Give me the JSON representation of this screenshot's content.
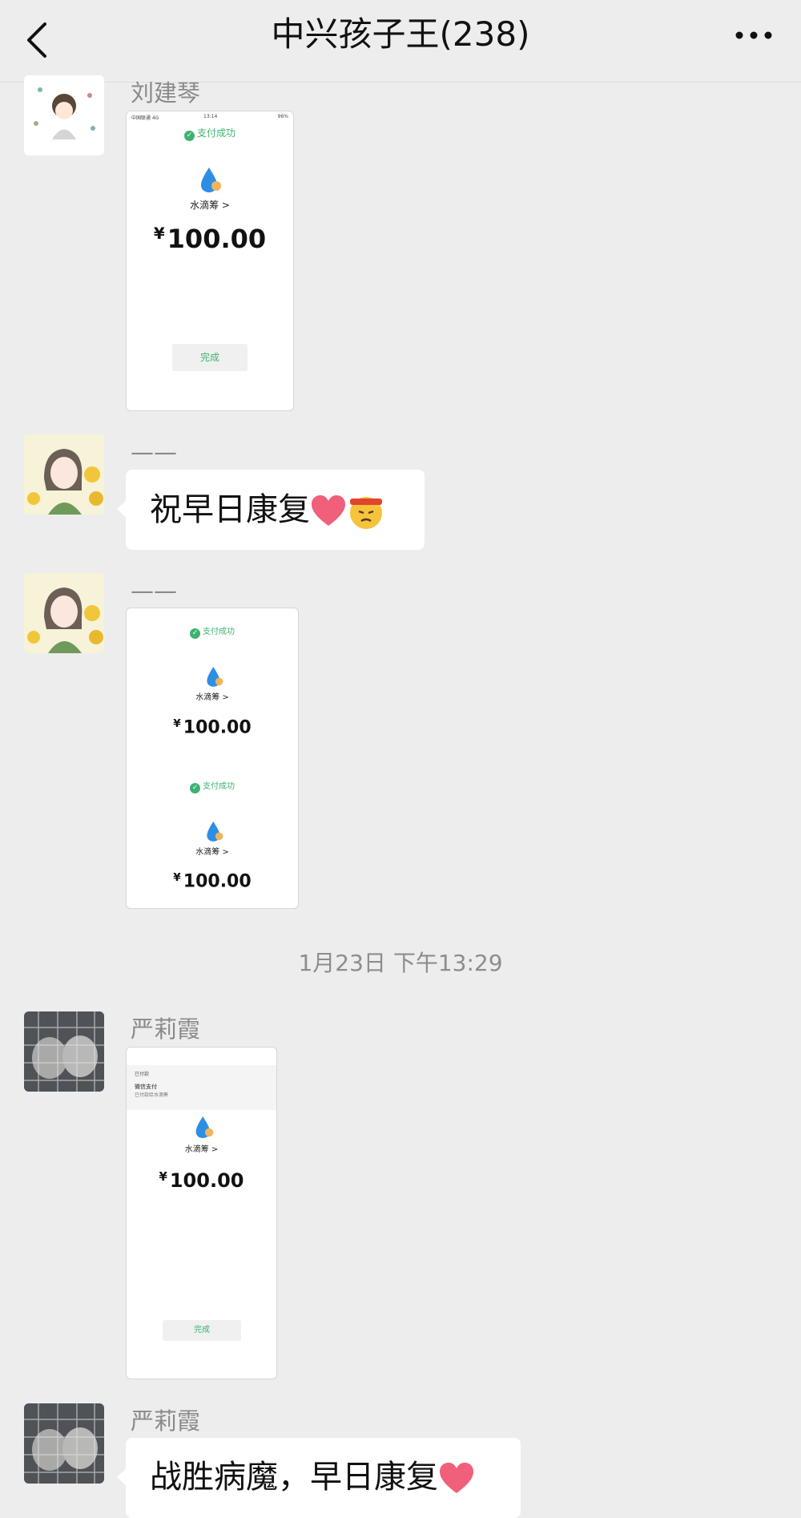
{
  "header": {
    "title": "中兴孩子王(238)",
    "back_icon": "chevron-left-icon",
    "more_icon": "more-dots-icon"
  },
  "messages": [
    {
      "sender": "刘建琴",
      "type": "image",
      "receipt": {
        "status_bar_left": "中国联通 4G",
        "status_bar_time": "13:14",
        "status_bar_right": "96%",
        "status": "支付成功",
        "merchant": "水滴筹 >",
        "amount": "100.00",
        "currency": "¥",
        "done": "完成"
      }
    },
    {
      "sender": "——",
      "type": "text",
      "text": "祝早日康复",
      "emojis": [
        "heart-emoji",
        "determined-face-emoji"
      ]
    },
    {
      "sender": "——",
      "type": "image",
      "receipts": [
        {
          "status": "支付成功",
          "merchant": "水滴筹 >",
          "amount": "100.00",
          "currency": "¥"
        },
        {
          "status": "支付成功",
          "merchant": "水滴筹 >",
          "amount": "100.00",
          "currency": "¥"
        }
      ]
    },
    {
      "timestamp": "1月23日 下午13:29"
    },
    {
      "sender": "严莉霞",
      "type": "image",
      "receipt": {
        "top_line": "已付款",
        "notice_title": "微信支付",
        "notice_sub": "已付款给水滴筹",
        "merchant": "水滴筹 >",
        "amount": "100.00",
        "currency": "¥",
        "done": "完成"
      }
    },
    {
      "sender": "严莉霞",
      "type": "text",
      "text": "战胜病魔，早日康复",
      "emojis": [
        "heart-emoji"
      ]
    }
  ],
  "colors": {
    "background": "#ededed",
    "bubble": "#ffffff",
    "pay_green": "#3cb371",
    "name_gray": "#8a8a8a"
  }
}
